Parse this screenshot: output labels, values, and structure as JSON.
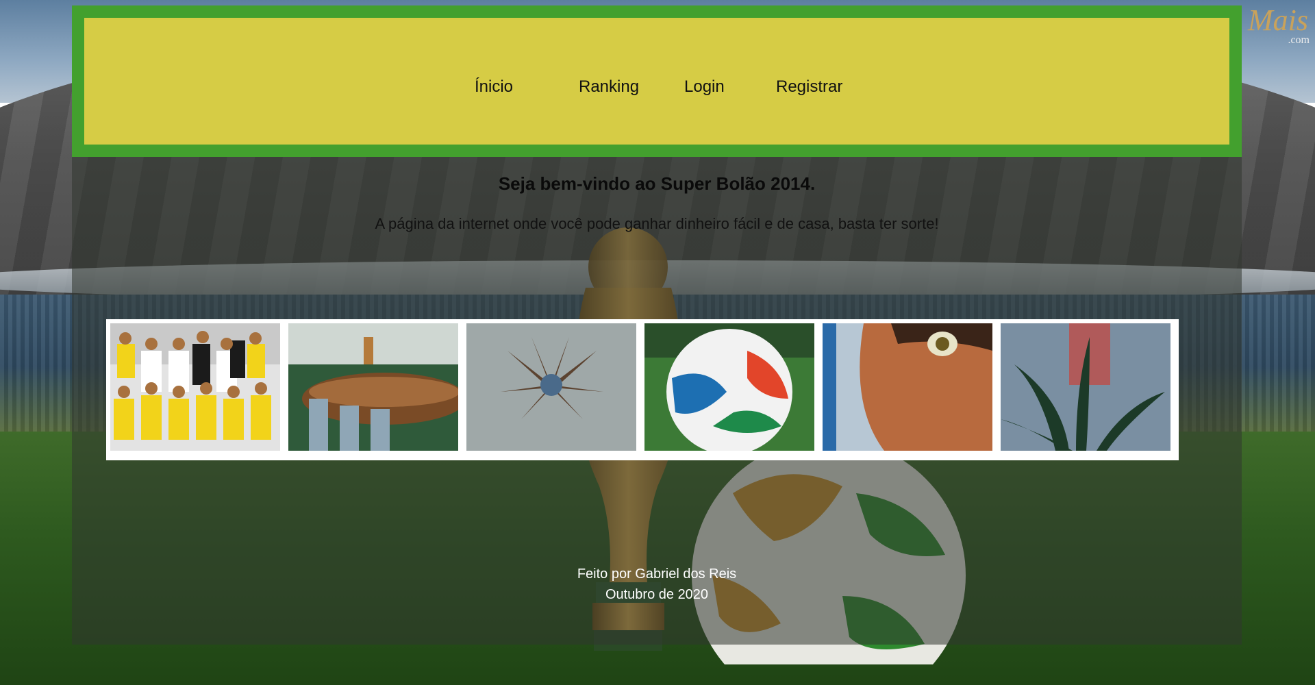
{
  "nav": {
    "items": [
      {
        "label": "Ínicio"
      },
      {
        "label": "Ranking"
      },
      {
        "label": "Login"
      },
      {
        "label": "Registrar"
      }
    ]
  },
  "main": {
    "welcome": "Seja bem-vindo ao Super Bolão 2014.",
    "tagline": "A página da internet onde você pode ganhar dinheiro fácil e de casa, basta ter sorte!"
  },
  "logo": {
    "main": "Mais",
    "sub": ".com"
  },
  "gallery": {
    "images": [
      {
        "name": "brazil-team-photo"
      },
      {
        "name": "ceremony-canoe-photo"
      },
      {
        "name": "ceremony-flower-stage-photo"
      },
      {
        "name": "brazuca-ball-photo"
      },
      {
        "name": "animated-character-photo"
      },
      {
        "name": "animated-plant-photo"
      }
    ]
  },
  "footer": {
    "line1": "Feito por Gabriel dos Reis",
    "line2": "Outubro de 2020"
  },
  "colors": {
    "header_green": "#43a02e",
    "header_yellow": "#d6cc45"
  }
}
